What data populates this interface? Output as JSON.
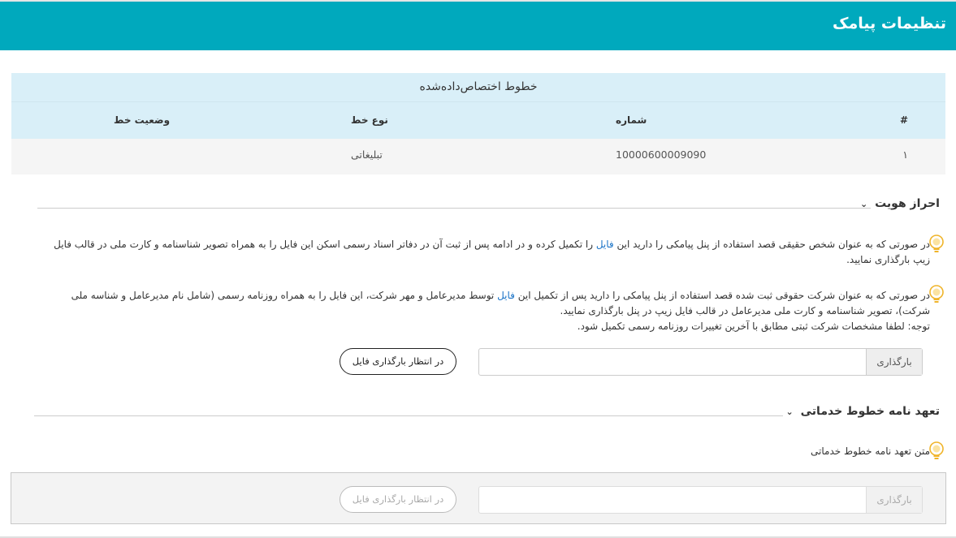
{
  "header": {
    "title": "تنظیمات پیامک"
  },
  "lines_table": {
    "caption": "خطوط اختصاص‌داده‌شده",
    "columns": {
      "index": "#",
      "number": "شماره",
      "type": "نوع خط",
      "status": "وضعیت خط"
    },
    "rows": [
      {
        "index": "۱",
        "number": "10000600009090",
        "type": "تبلیغاتی",
        "status": ""
      }
    ]
  },
  "identity": {
    "title": "احراز هویت",
    "note1_a": "در صورتی که به عنوان شخص حقیقی قصد استفاده از پنل پیامکی را دارید این ",
    "note1_link": "فایل",
    "note1_b": " را تکمیل کرده و در ادامه پس از ثبت آن در دفاتر اسناد رسمی اسکن این فایل را به همراه تصویر شناسنامه و کارت ملی در قالب فایل زیپ بارگذاری نمایید.",
    "note2_a": "در صورتی که به عنوان شرکت حقوقی ثبت شده قصد استفاده از پنل پیامکی را دارید پس از تکمیل این ",
    "note2_link": "فایل",
    "note2_b": " توسط مدیرعامل و مهر شرکت، این فایل را به همراه روزنامه رسمی (شامل نام مدیرعامل و شناسه ملی شرکت)، تصویر شناسنامه و کارت ملی مدیرعامل در قالب فایل زیپ در پنل بارگذاری نمایید.",
    "note2_c": "توجه: لطفا مشخصات شرکت ثبتی مطابق با آخرین تغییرات روزنامه رسمی تکمیل شود.",
    "upload_label": "بارگذاری",
    "upload_status": "در انتظار بارگذاری فایل"
  },
  "commitment": {
    "title": "تعهد نامه خطوط خدماتی",
    "note": "متن تعهد نامه خطوط خدماتی",
    "upload_label": "بارگذاری",
    "upload_status": "در انتظار بارگذاری فایل"
  },
  "colors": {
    "header": "#00a9bd",
    "table_head": "#d9eff8",
    "link": "#1a73c7",
    "bulb": "#f0b429"
  },
  "icons": {
    "bulb": "lightbulb-icon",
    "chevron": "chevron-down-icon"
  }
}
